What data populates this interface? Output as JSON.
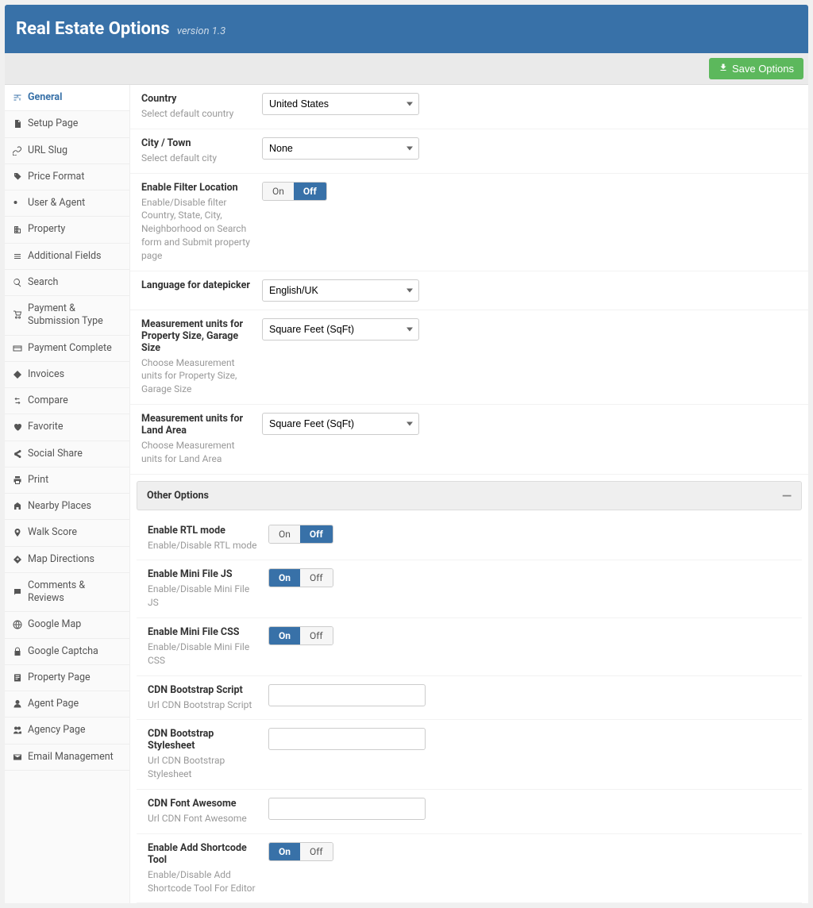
{
  "header": {
    "title": "Real Estate Options",
    "version": "version 1.3"
  },
  "toolbar": {
    "save_label": "Save Options"
  },
  "sidebar": {
    "items": [
      {
        "label": "General",
        "active": true
      },
      {
        "label": "Setup Page"
      },
      {
        "label": "URL Slug"
      },
      {
        "label": "Price Format"
      },
      {
        "label": "User & Agent"
      },
      {
        "label": "Property"
      },
      {
        "label": "Additional Fields"
      },
      {
        "label": "Search"
      },
      {
        "label": "Payment & Submission Type"
      },
      {
        "label": "Payment Complete"
      },
      {
        "label": "Invoices"
      },
      {
        "label": "Compare"
      },
      {
        "label": "Favorite"
      },
      {
        "label": "Social Share"
      },
      {
        "label": "Print"
      },
      {
        "label": "Nearby Places"
      },
      {
        "label": "Walk Score"
      },
      {
        "label": "Map Directions"
      },
      {
        "label": "Comments & Reviews"
      },
      {
        "label": "Google Map"
      },
      {
        "label": "Google Captcha"
      },
      {
        "label": "Property Page"
      },
      {
        "label": "Agent Page"
      },
      {
        "label": "Agency Page"
      },
      {
        "label": "Email Management"
      }
    ]
  },
  "fields": {
    "country": {
      "label": "Country",
      "desc": "Select default country",
      "value": "United States"
    },
    "city": {
      "label": "City / Town",
      "desc": "Select default city",
      "value": "None"
    },
    "filter_loc": {
      "label": "Enable Filter Location",
      "desc": "Enable/Disable filter Country, State, City, Neighborhood on Search form and Submit property page"
    },
    "datepicker_lang": {
      "label": "Language for datepicker",
      "value": "English/UK"
    },
    "units_prop": {
      "label": "Measurement units for Property Size, Garage Size",
      "desc": "Choose Measurement units for Property Size, Garage Size",
      "value": "Square Feet (SqFt)"
    },
    "units_land": {
      "label": "Measurement units for Land Area",
      "desc": "Choose Measurement units for Land Area",
      "value": "Square Feet (SqFt)"
    }
  },
  "other_section": {
    "title": "Other Options",
    "rtl": {
      "label": "Enable RTL mode",
      "desc": "Enable/Disable RTL mode"
    },
    "mini_js": {
      "label": "Enable Mini File JS",
      "desc": "Enable/Disable Mini File JS"
    },
    "mini_css": {
      "label": "Enable Mini File CSS",
      "desc": "Enable/Disable Mini File CSS"
    },
    "cdn_script": {
      "label": "CDN Bootstrap Script",
      "desc": "Url CDN Bootstrap Script"
    },
    "cdn_style": {
      "label": "CDN Bootstrap Stylesheet",
      "desc": "Url CDN Bootstrap Stylesheet"
    },
    "cdn_fa": {
      "label": "CDN Font Awesome",
      "desc": "Url CDN Font Awesome"
    },
    "shortcode": {
      "label": "Enable Add Shortcode Tool",
      "desc": "Enable/Disable Add Shortcode Tool For Editor"
    }
  },
  "toggle": {
    "on": "On",
    "off": "Off"
  }
}
